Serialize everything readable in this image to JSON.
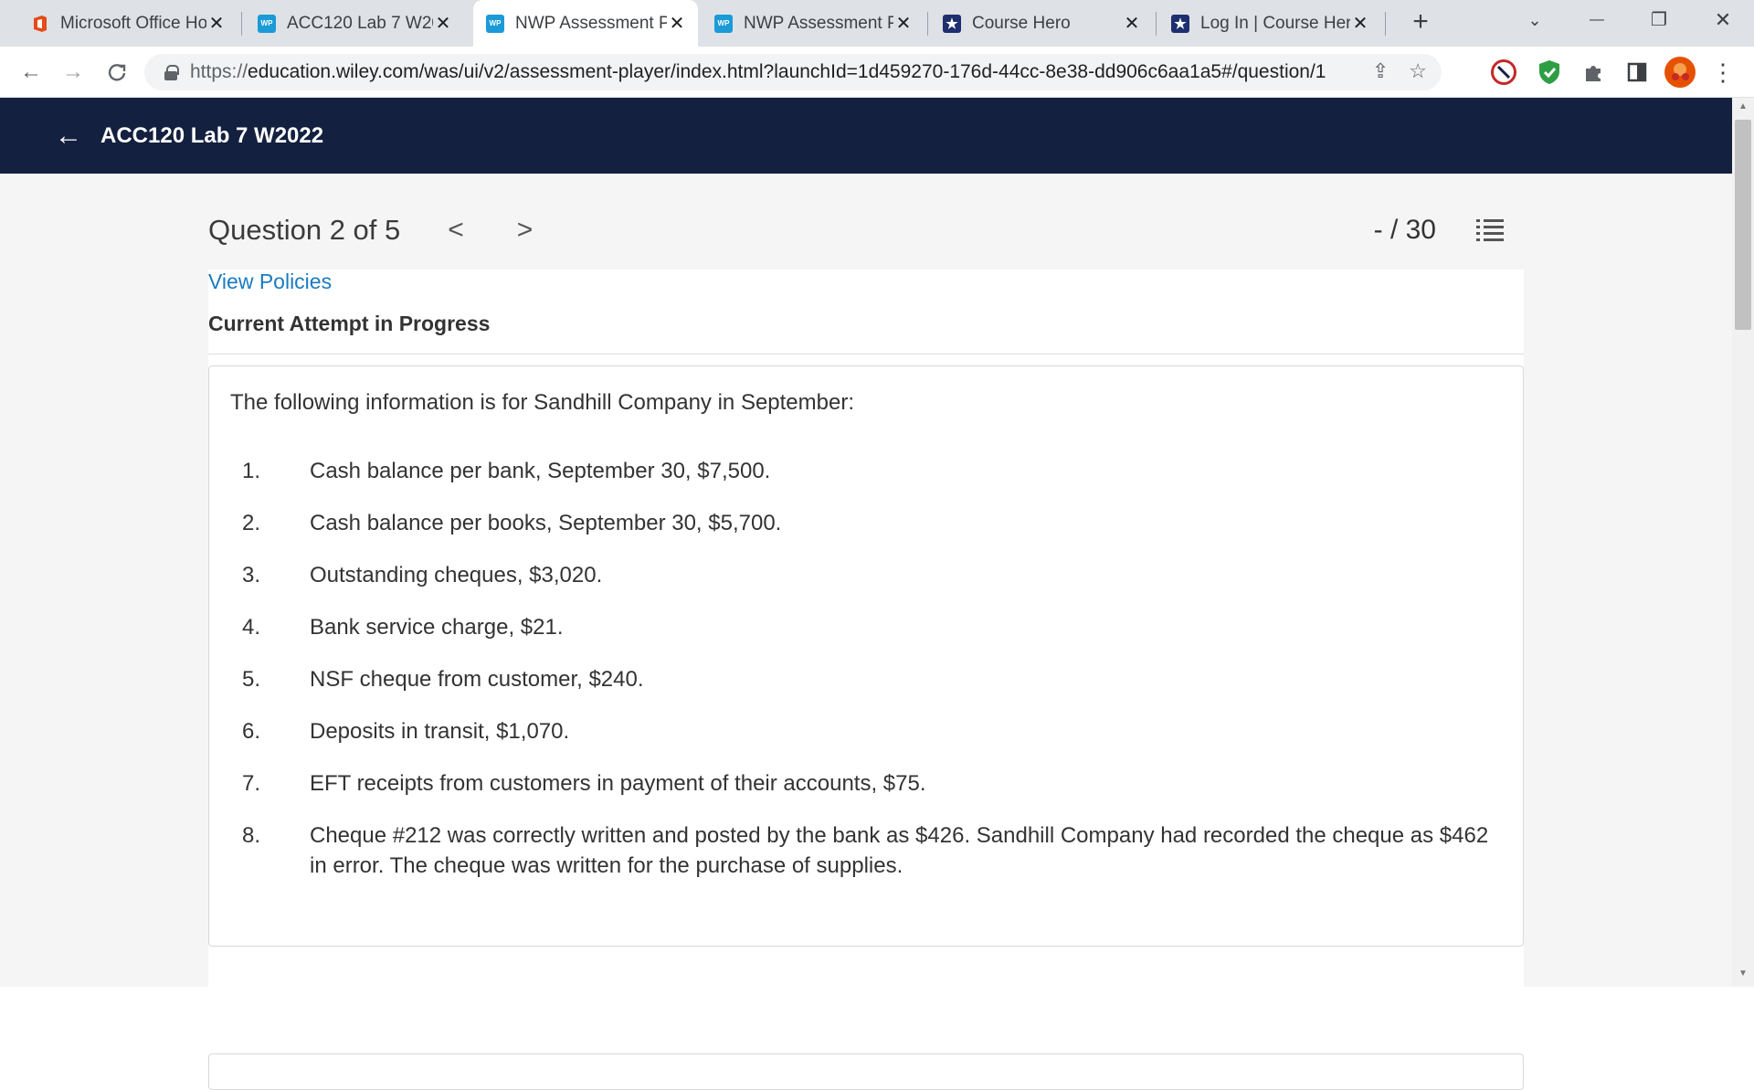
{
  "browser": {
    "tabs": [
      {
        "title": "Microsoft Office Ho",
        "favicon": "office-icon",
        "active": false
      },
      {
        "title": "ACC120 Lab 7 W20",
        "favicon": "wp-icon",
        "active": false
      },
      {
        "title": "NWP Assessment P",
        "favicon": "wp-icon",
        "active": true
      },
      {
        "title": "NWP Assessment P",
        "favicon": "wp-icon",
        "active": false
      },
      {
        "title": "Course Hero",
        "favicon": "coursehero-icon",
        "active": false
      },
      {
        "title": "Log In | Course Her",
        "favicon": "coursehero-icon",
        "active": false
      }
    ],
    "favicon_text": {
      "wp": "WP",
      "ch": "★"
    },
    "new_tab_label": "+",
    "close_glyph": "✕",
    "window": {
      "dropdown": "⌄",
      "minimize": "—",
      "restore": "❐",
      "close": "✕"
    },
    "nav": {
      "back": "←",
      "forward": "→",
      "reload": "C"
    },
    "url": {
      "protocol": "https://",
      "rest": "education.wiley.com/was/ui/v2/assessment-player/index.html?launchId=1d459270-176d-44cc-8e38-dd906c6aa1a5#/question/1"
    },
    "url_actions": {
      "share": "⇪",
      "bookmark": "☆"
    },
    "extensions": {
      "menu": "⋮"
    }
  },
  "app": {
    "back_arrow": "←",
    "title": "ACC120 Lab 7 W2022"
  },
  "question": {
    "label": "Question 2 of 5",
    "prev": "<",
    "next": ">",
    "score": "- / 30",
    "view_policies": "View Policies",
    "attempt_status": "Current Attempt in Progress",
    "intro": "The following information is for Sandhill Company in September:",
    "items": [
      {
        "num": "1.",
        "text": "Cash balance per bank, September 30, $7,500."
      },
      {
        "num": "2.",
        "text": "Cash balance per books, September 30, $5,700."
      },
      {
        "num": "3.",
        "text": "Outstanding cheques, $3,020."
      },
      {
        "num": "4.",
        "text": "Bank service charge, $21."
      },
      {
        "num": "5.",
        "text": "NSF cheque from customer, $240."
      },
      {
        "num": "6.",
        "text": "Deposits in transit, $1,070."
      },
      {
        "num": "7.",
        "text": "EFT receipts from customers in payment of their accounts, $75."
      },
      {
        "num": "8.",
        "text": "Cheque #212 was correctly written and posted by the bank as $426. Sandhill Company had recorded the cheque as $462 in error. The cheque was written for the purchase of supplies."
      }
    ]
  },
  "colors": {
    "header_bg": "#13203f",
    "link": "#1a7bbf",
    "wp_favicon": "#1a9bd7",
    "coursehero_favicon": "#1f2e6e"
  }
}
